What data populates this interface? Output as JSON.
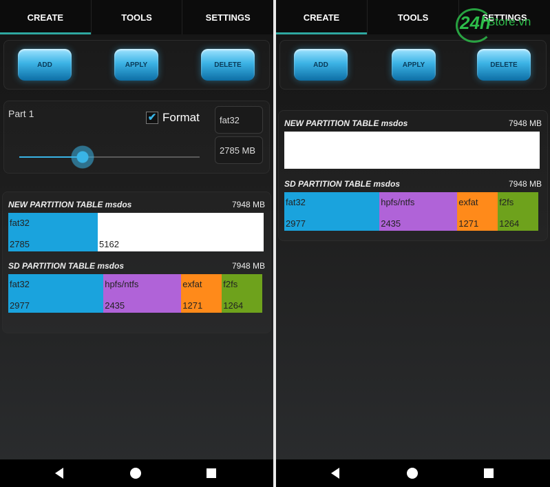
{
  "left": {
    "tabs": [
      "CREATE",
      "TOOLS",
      "SETTINGS"
    ],
    "buttons": {
      "add": "ADD",
      "apply": "APPLY",
      "delete": "DELETE"
    },
    "part": {
      "label": "Part 1",
      "format_checked": true,
      "check_mark": "✔",
      "format_label": "Format",
      "fs_value": "fat32",
      "size_value": "2785 MB",
      "slider_fraction": 0.35
    },
    "new_table": {
      "title": "NEW PARTITION TABLE msdos",
      "size": "7948 MB",
      "segments": [
        {
          "name": "fat32",
          "value": "2785",
          "amount": 2785,
          "color": "#1aa3dd"
        },
        {
          "name": "",
          "value": "5162",
          "amount": 5162,
          "color": "#ffffff"
        }
      ]
    },
    "sd_table": {
      "title": "SD PARTITION TABLE msdos",
      "size": "7948 MB",
      "segments": [
        {
          "name": "fat32",
          "value": "2977",
          "amount": 2977,
          "color": "#1aa3dd"
        },
        {
          "name": "hpfs/ntfs",
          "value": "2435",
          "amount": 2435,
          "color": "#b063d8"
        },
        {
          "name": "exfat",
          "value": "1271",
          "amount": 1271,
          "color": "#ff8a1a"
        },
        {
          "name": "f2fs",
          "value": "1264",
          "amount": 1264,
          "color": "#6ea21c"
        }
      ]
    }
  },
  "right": {
    "tabs": [
      "CREATE",
      "TOOLS",
      "SETTINGS"
    ],
    "buttons": {
      "add": "ADD",
      "apply": "APPLY",
      "delete": "DELETE"
    },
    "new_table": {
      "title": "NEW PARTITION TABLE msdos",
      "size": "7948 MB"
    },
    "sd_table": {
      "title": "SD PARTITION TABLE msdos",
      "size": "7948 MB",
      "segments": [
        {
          "name": "fat32",
          "value": "2977",
          "amount": 2977,
          "color": "#1aa3dd"
        },
        {
          "name": "hpfs/ntfs",
          "value": "2435",
          "amount": 2435,
          "color": "#b063d8"
        },
        {
          "name": "exfat",
          "value": "1271",
          "amount": 1271,
          "color": "#ff8a1a"
        },
        {
          "name": "f2fs",
          "value": "1264",
          "amount": 1264,
          "color": "#6ea21c"
        }
      ]
    }
  },
  "watermark": {
    "number": "24h",
    "text": "Store.vn"
  },
  "icons": {
    "back": "back-icon",
    "home": "home-icon",
    "recent": "recent-apps-icon",
    "check": "checkmark-icon"
  }
}
